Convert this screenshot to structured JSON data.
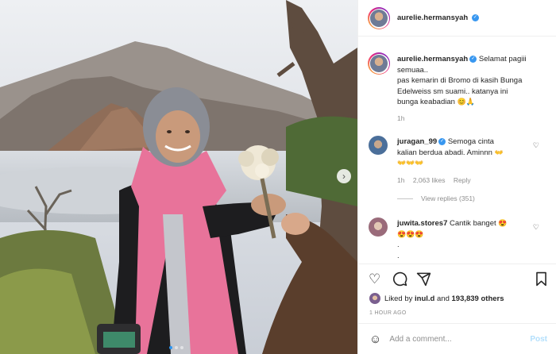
{
  "post": {
    "username": "aurelie.hermansyah",
    "caption_lines": [
      "Selamat pagiii",
      "semuaa..",
      "pas kemarin di Bromo di kasih Bunga",
      "Edelweiss sm suami.. katanya ini",
      "bunga keabadian"
    ],
    "caption_time": "1h"
  },
  "comments": [
    {
      "username": "juragan_99",
      "text_lines": [
        "Semoga cinta",
        "kalian berdua abadi. Aminnn"
      ],
      "emoji_line": "👐👐👐",
      "time": "1h",
      "likes": "2,063 likes",
      "reply": "Reply",
      "view_replies": "View replies (351)"
    },
    {
      "username": "juwita.stores7",
      "text": "Cantik banget",
      "emoji_line": "😍😍😍",
      "extra_lines": [
        ".",
        "."
      ]
    }
  ],
  "actions": {
    "liked_by_prefix": "Liked by ",
    "liked_by_user": "inul.d",
    "liked_by_mid": " and ",
    "liked_by_count": "193,839 others",
    "time_ago": "1 HOUR AGO"
  },
  "add_comment": {
    "placeholder": "Add a comment...",
    "post_label": "Post"
  },
  "icons": {
    "heart": "heart-icon",
    "comment": "comment-icon",
    "share": "share-icon",
    "bookmark": "bookmark-icon",
    "smile": "emoji-icon",
    "verified": "verified-badge-icon"
  },
  "colors": {
    "accent": "#3897f0",
    "post_disabled": "#b2dffc",
    "scarf": "#e8739a"
  }
}
